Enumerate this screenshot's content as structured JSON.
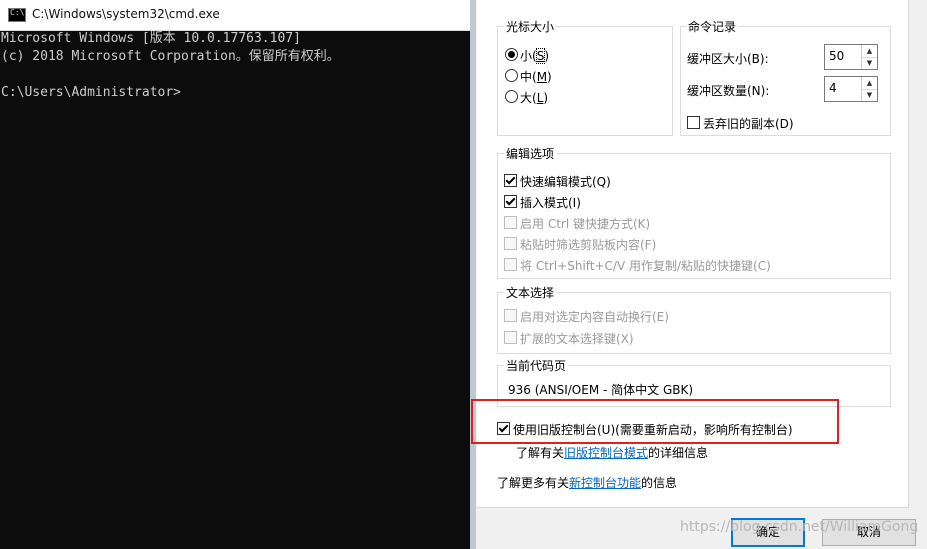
{
  "cmd": {
    "title": "C:\\Windows\\system32\\cmd.exe",
    "icon_text": "C:\\",
    "lines": [
      "Microsoft Windows [版本 10.0.17763.107]",
      "(c) 2018 Microsoft Corporation。保留所有权利。",
      "",
      "C:\\Users\\Administrator>"
    ]
  },
  "dialog": {
    "cursor_size": {
      "title": "光标大小",
      "options": [
        {
          "label": "小(",
          "key": "S",
          "suffix": ")",
          "selected": true
        },
        {
          "label": "中(",
          "key": "M",
          "suffix": ")",
          "selected": false
        },
        {
          "label": "大(",
          "key": "L",
          "suffix": ")",
          "selected": false
        }
      ]
    },
    "command_history": {
      "title": "命令记录",
      "buffer_size_label": "缓冲区大小(B):",
      "buffer_size_value": "50",
      "buffer_count_label": "缓冲区数量(N):",
      "buffer_count_value": "4",
      "discard_label": "丢弃旧的副本(D)"
    },
    "edit_options": {
      "title": "编辑选项",
      "items": [
        {
          "label": "快速编辑模式(Q)",
          "checked": true,
          "enabled": true
        },
        {
          "label": "插入模式(I)",
          "checked": true,
          "enabled": true
        },
        {
          "label": "启用 Ctrl 键快捷方式(K)",
          "checked": false,
          "enabled": false
        },
        {
          "label": "粘贴时筛选剪贴板内容(F)",
          "checked": false,
          "enabled": false
        },
        {
          "label": "将 Ctrl+Shift+C/V 用作复制/粘贴的快捷键(C)",
          "checked": false,
          "enabled": false
        }
      ]
    },
    "text_selection": {
      "title": "文本选择",
      "items": [
        {
          "label": "启用对选定内容自动换行(E)",
          "checked": false,
          "enabled": false
        },
        {
          "label": "扩展的文本选择键(X)",
          "checked": false,
          "enabled": false
        }
      ]
    },
    "code_page": {
      "title": "当前代码页",
      "value": "936   (ANSI/OEM - 简体中文 GBK)"
    },
    "legacy_console": {
      "label": "使用旧版控制台(U)(需要重新启动，影响所有控制台)",
      "checked": true,
      "info_prefix": "了解有关",
      "info_link": "旧版控制台模式",
      "info_suffix": "的详细信息"
    },
    "new_features": {
      "prefix": "了解更多有关",
      "link": "新控制台功能",
      "suffix": "的信息"
    },
    "buttons": {
      "ok": "确定",
      "cancel": "取消"
    }
  },
  "watermark": "https://blog.csdn.net/WilliamGong",
  "colors": {
    "highlight": "#e02020",
    "link": "#0066cc",
    "console_bg": "#0c0c0c",
    "console_text": "#cccccc"
  }
}
